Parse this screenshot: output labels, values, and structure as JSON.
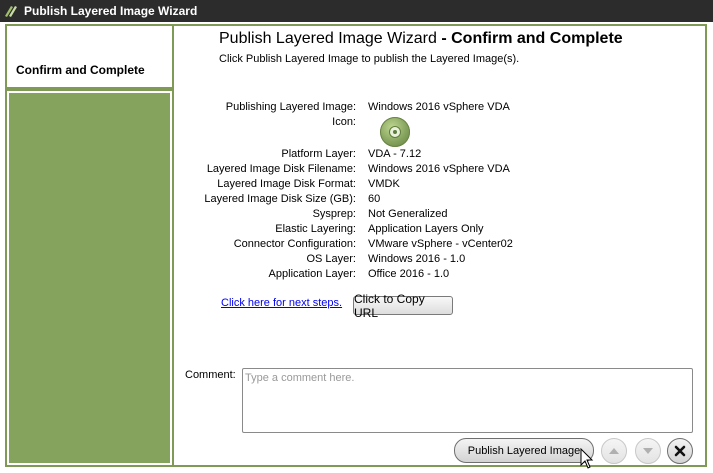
{
  "window": {
    "title": "Publish Layered Image Wizard",
    "logo_icon": "citrix-app-layering-icon"
  },
  "steps": [
    {
      "label": "Confirm and Complete",
      "active": true
    }
  ],
  "header": {
    "title": "Publish Layered Image Wizard",
    "title_suffix": " - Confirm and Complete",
    "subtitle": "Click Publish Layered Image to publish the Layered Image(s)."
  },
  "summary": {
    "publishing_label": "Publishing Layered Image:",
    "publishing_value": "Windows 2016 vSphere VDA",
    "icon_label": "Icon:",
    "icon_name": "disc-icon",
    "platform_label": "Platform Layer:",
    "platform_value": "VDA - 7.12",
    "filename_label": "Layered Image Disk Filename:",
    "filename_value": "Windows 2016 vSphere VDA",
    "format_label": "Layered Image Disk Format:",
    "format_value": "VMDK",
    "size_label": "Layered Image Disk Size (GB):",
    "size_value": "60",
    "sysprep_label": "Sysprep:",
    "sysprep_value": "Not Generalized",
    "elastic_label": "Elastic Layering:",
    "elastic_value": "Application Layers Only",
    "connector_label": "Connector Configuration:",
    "connector_value": "VMware vSphere - vCenter02",
    "os_label": "OS Layer:",
    "os_value": "Windows 2016 - 1.0",
    "app_label": "Application Layer:",
    "app_value": "Office 2016 - 1.0"
  },
  "links": {
    "next_steps": "Click here for next steps.",
    "copy_url": "Click to Copy URL"
  },
  "comment": {
    "label": "Comment:",
    "value": "",
    "placeholder": "Type a comment here."
  },
  "footer": {
    "publish_label": "Publish Layered Image",
    "up_icon": "arrow-up-icon",
    "down_icon": "arrow-down-icon",
    "close_icon": "close-icon"
  },
  "colors": {
    "accent": "#86a35e",
    "border": "#7f9a55",
    "titlebar": "#2c2c2c",
    "link": "#0000ee"
  }
}
